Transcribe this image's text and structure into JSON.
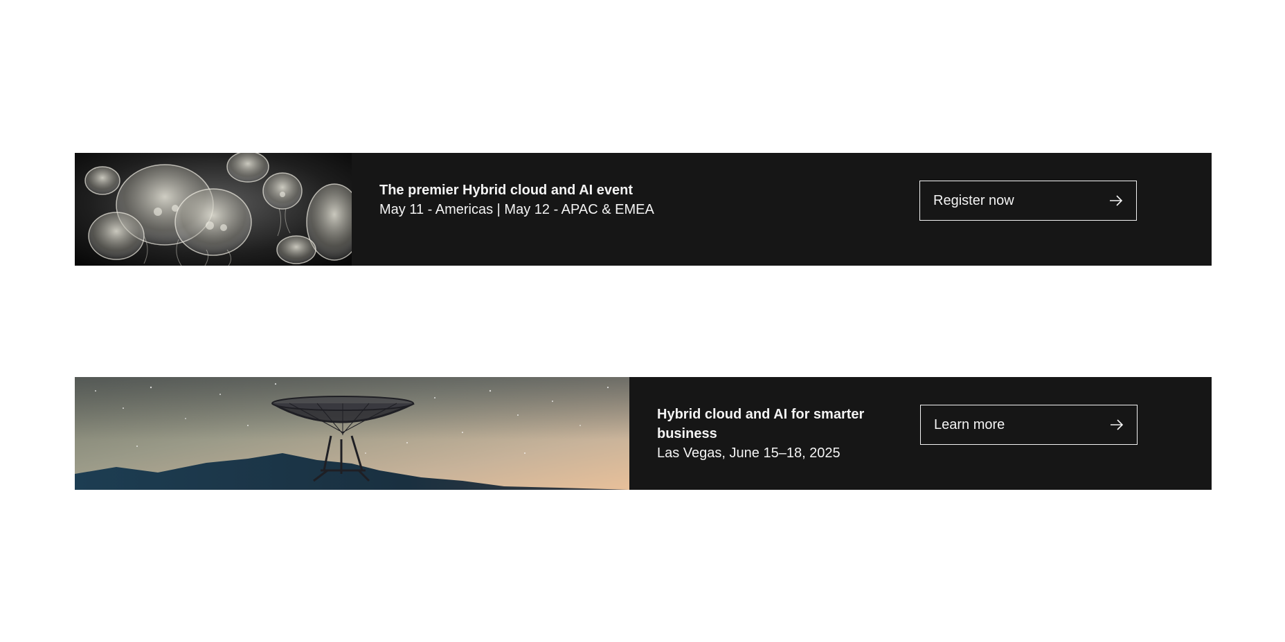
{
  "banners": [
    {
      "title": "The premier Hybrid cloud and AI event",
      "subtitle": "May 11 - Americas | May 12 - APAC & EMEA",
      "cta_label": "Register now",
      "image_subject": "jellyfish",
      "cta_icon": "arrow-right-icon"
    },
    {
      "title": "Hybrid cloud and AI for smarter business",
      "subtitle": "Las Vegas, June 15–18, 2025",
      "cta_label": "Learn more",
      "image_subject": "radio-telescope-under-milky-way",
      "cta_icon": "arrow-right-icon"
    }
  ],
  "colors": {
    "page_background": "#ffffff",
    "banner_background": "#161616",
    "banner_text": "#f4f4f4"
  }
}
